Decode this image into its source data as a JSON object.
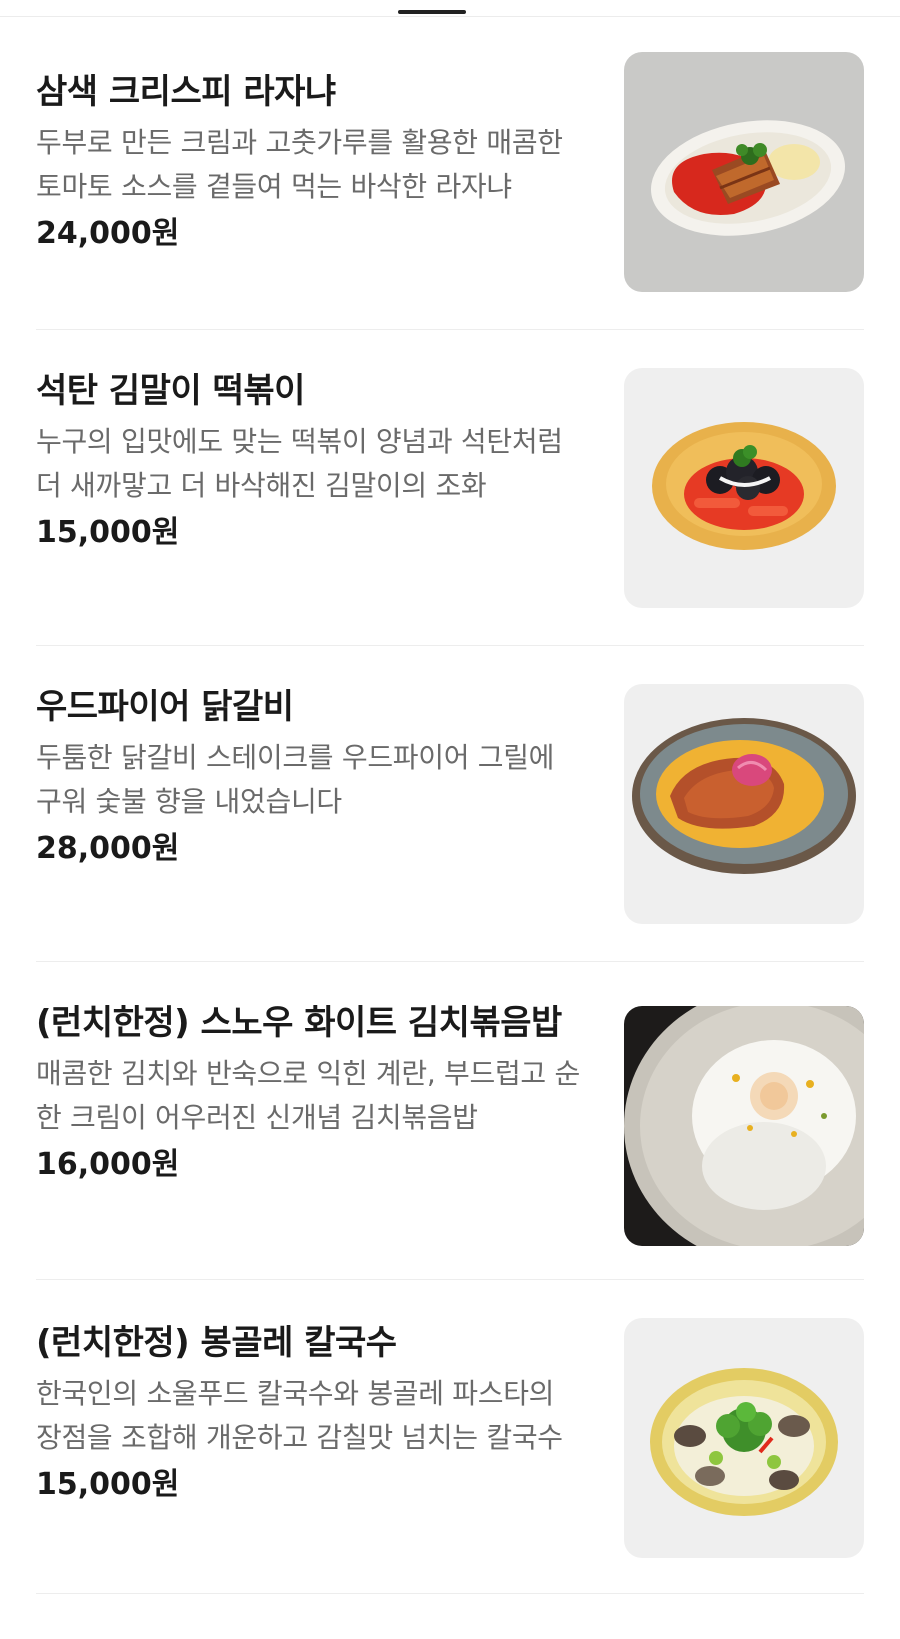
{
  "menu": {
    "items": [
      {
        "name": "삼색 크리스피 라자냐",
        "description": "두부로 만든 크림과 고춧가루를 활용한 매콤한 토마토 소스를 곁들여 먹는 바삭한 라자냐",
        "price": "24,000원",
        "image": "lasagna-dish-photo"
      },
      {
        "name": "석탄 김말이 떡볶이",
        "description": "누구의 입맛에도 맞는 떡볶이 양념과 석탄처럼 더 새까맣고 더 바삭해진 김말이의 조화",
        "price": "15,000원",
        "image": "tteokbokki-dish-photo"
      },
      {
        "name": "우드파이어 닭갈비",
        "description": "두툼한 닭갈비 스테이크를 우드파이어 그릴에 구워 숯불 향을 내었습니다",
        "price": "28,000원",
        "image": "dakgalbi-dish-photo"
      },
      {
        "name": "(런치한정) 스노우 화이트 김치볶음밥",
        "description": "매콤한 김치와 반숙으로 익힌 계란, 부드럽고 순한 크림이 어우러진 신개념 김치볶음밥",
        "price": "16,000원",
        "image": "kimchi-fried-rice-dish-photo"
      },
      {
        "name": "(런치한정) 봉골레 칼국수",
        "description": "한국인의 소울푸드 칼국수와 봉골레 파스타의 장점을 조합해 개운하고 감칠맛 넘치는 칼국수",
        "price": "15,000원",
        "image": "vongole-kalguksu-dish-photo"
      }
    ]
  }
}
